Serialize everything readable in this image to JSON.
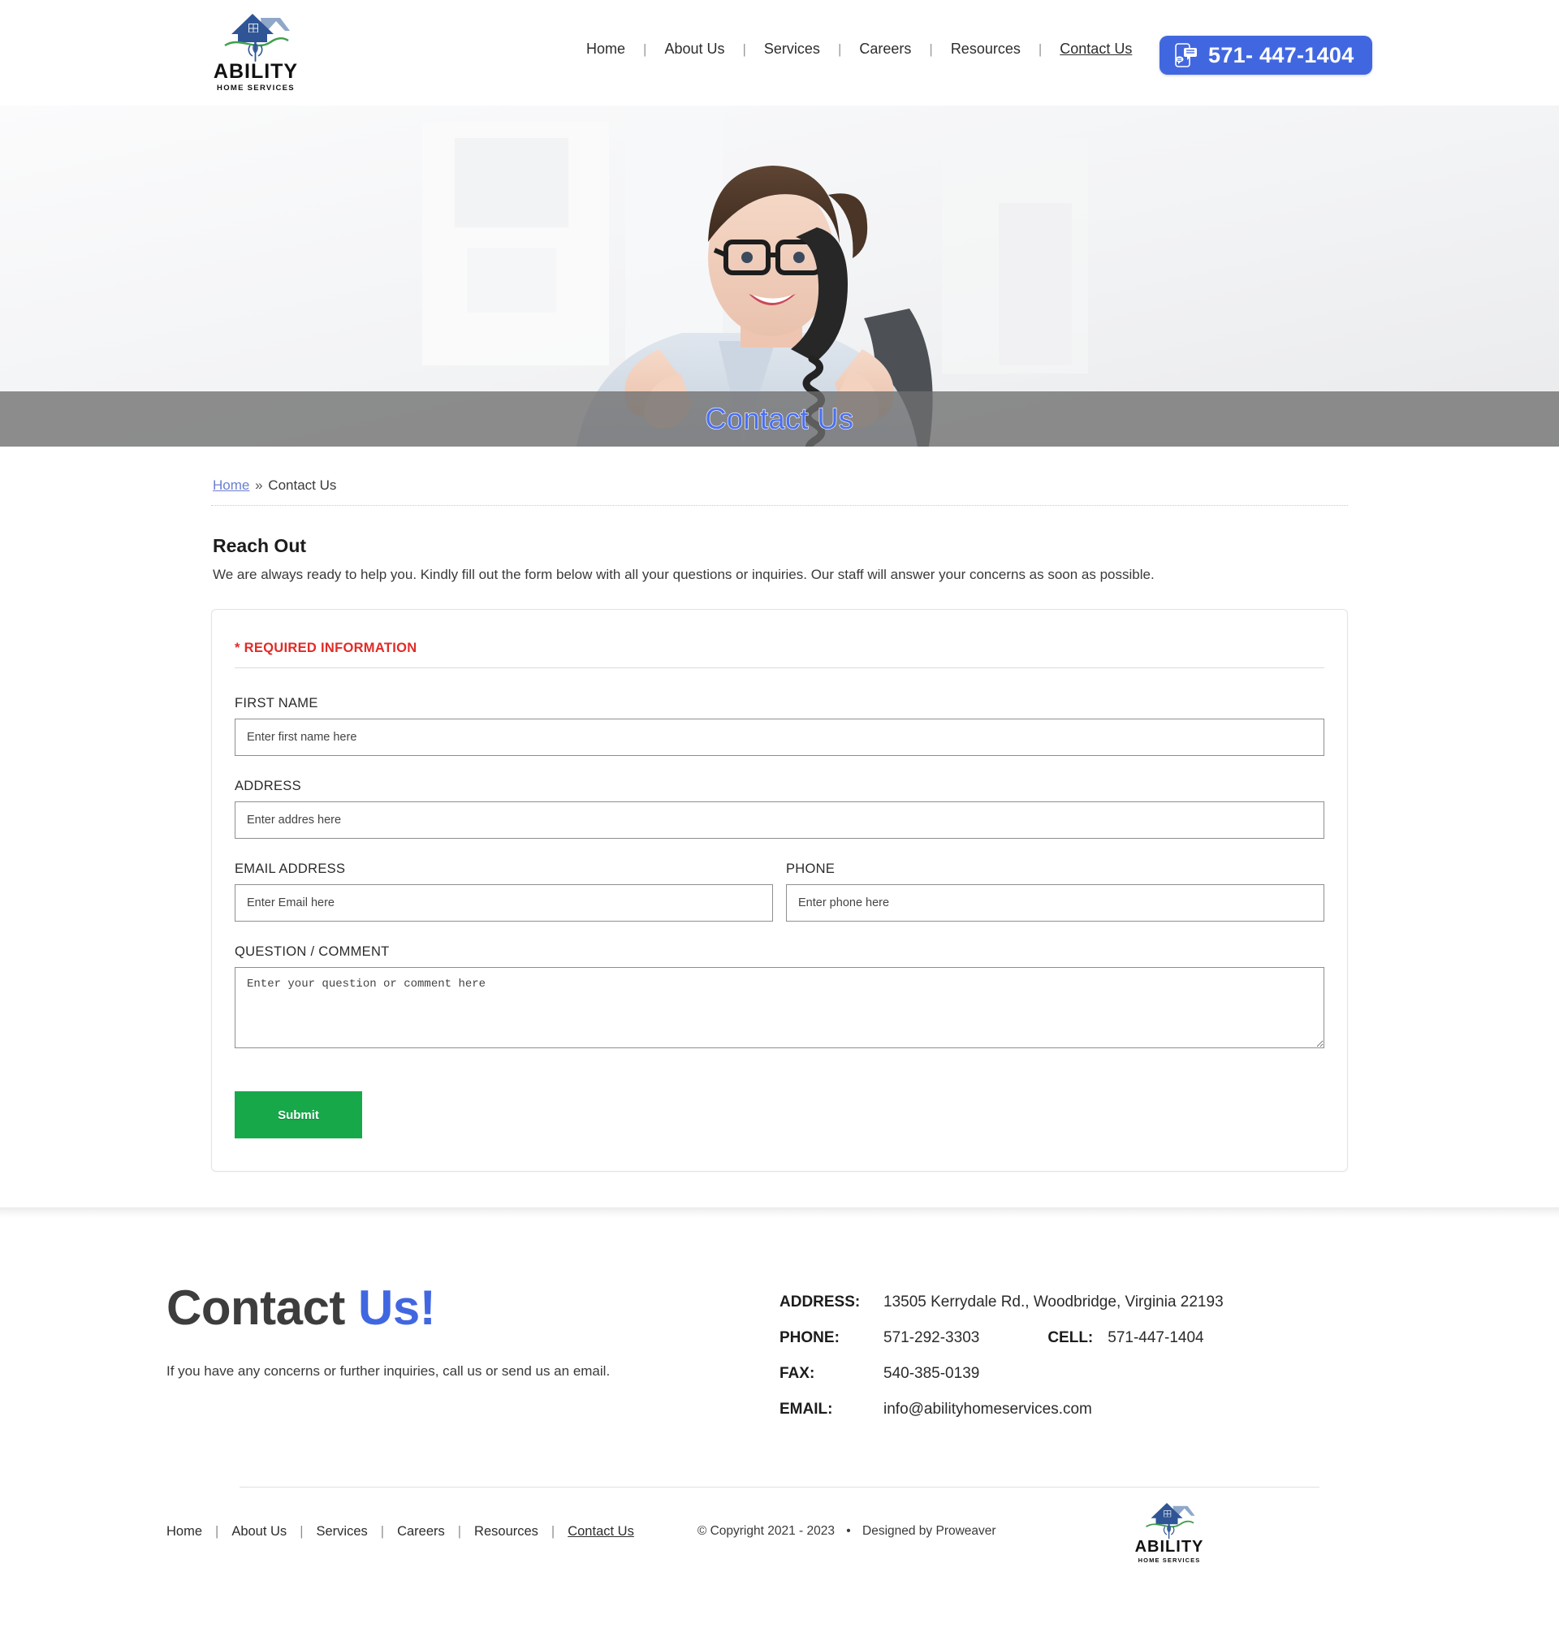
{
  "header": {
    "logo": {
      "name": "ABILITY",
      "tagline": "HOME SERVICES"
    },
    "nav": [
      {
        "label": "Home",
        "active": false
      },
      {
        "label": "About Us",
        "active": false
      },
      {
        "label": "Services",
        "active": false
      },
      {
        "label": "Careers",
        "active": false
      },
      {
        "label": "Resources",
        "active": false
      },
      {
        "label": "Contact Us",
        "active": true
      }
    ],
    "phone_button": {
      "label": "571- 447-1404",
      "icon": "mobile-chat-icon",
      "color": "#4167e0"
    }
  },
  "hero": {
    "title": "Contact Us",
    "title_color": "#4a6ff0",
    "bar_color": "#6e6e6e",
    "image_alt": "smiling-receptionist-on-phone"
  },
  "breadcrumb": {
    "home": "Home",
    "separator": "»",
    "current": "Contact Us"
  },
  "main": {
    "section_title": "Reach Out",
    "section_desc": "We are always ready to help you. Kindly fill out the form below with all your questions or inquiries. Our staff will answer your concerns as soon as possible.",
    "form": {
      "required_note": "* REQUIRED INFORMATION",
      "required_color": "#e02b27",
      "first_name": {
        "label": "FIRST NAME",
        "placeholder": "Enter first name here",
        "value": ""
      },
      "address": {
        "label": "ADDRESS",
        "placeholder": "Enter addres here",
        "value": ""
      },
      "email": {
        "label": "EMAIL ADDRESS",
        "placeholder": "Enter Email here",
        "value": ""
      },
      "phone": {
        "label": "PHONE",
        "placeholder": "Enter phone here",
        "value": ""
      },
      "question": {
        "label": "QUESTION / COMMENT",
        "placeholder": "Enter your question or comment here",
        "value": ""
      },
      "submit_label": "Submit",
      "submit_color": "#17a84a"
    }
  },
  "footer": {
    "heading_main": "Contact ",
    "heading_accent": "Us!",
    "accent_color": "#4167e0",
    "tagline": "If you have any concerns or further inquiries, call us or send us an email.",
    "contact": {
      "address_label": "ADDRESS:",
      "address_value": "13505 Kerrydale Rd., Woodbridge, Virginia 22193",
      "phone_label": "PHONE:",
      "phone_value": "571-292-3303",
      "cell_label": "CELL:",
      "cell_value": "571-447-1404",
      "fax_label": "FAX:",
      "fax_value": "540-385-0139",
      "email_label": "EMAIL:",
      "email_value": "info@abilityhomeservices.com"
    },
    "nav": [
      {
        "label": "Home",
        "active": false
      },
      {
        "label": "About Us",
        "active": false
      },
      {
        "label": "Services",
        "active": false
      },
      {
        "label": "Careers",
        "active": false
      },
      {
        "label": "Resources",
        "active": false
      },
      {
        "label": "Contact Us",
        "active": true
      }
    ],
    "copyright": "© Copyright 2021 - 2023",
    "dot": "•",
    "designer": "Designed by Proweaver",
    "logo": {
      "name": "ABILITY",
      "tagline": "HOME SERVICES"
    }
  }
}
